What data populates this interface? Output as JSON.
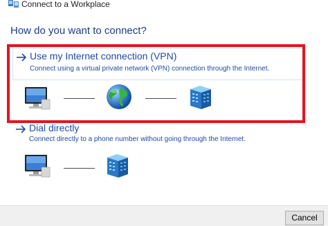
{
  "window": {
    "title": "Connect to a Workplace",
    "icon": "network-workplace-icon"
  },
  "heading": "How do you want to connect?",
  "options": [
    {
      "title": "Use my Internet connection (VPN)",
      "description": "Connect using a virtual private network (VPN) connection through the Internet.",
      "selected": true,
      "icons": [
        "computer-icon",
        "globe-icon",
        "server-icon"
      ]
    },
    {
      "title": "Dial directly",
      "description": "Connect directly to a phone number without going through the Internet.",
      "selected": false,
      "icons": [
        "computer-icon",
        "server-icon"
      ]
    }
  ],
  "footer": {
    "cancel_label": "Cancel"
  },
  "colors": {
    "link_blue": "#1e4aa8",
    "heading_blue": "#1a3a8c",
    "highlight_red": "#e3141f",
    "selection_border": "#cfe3f7"
  }
}
